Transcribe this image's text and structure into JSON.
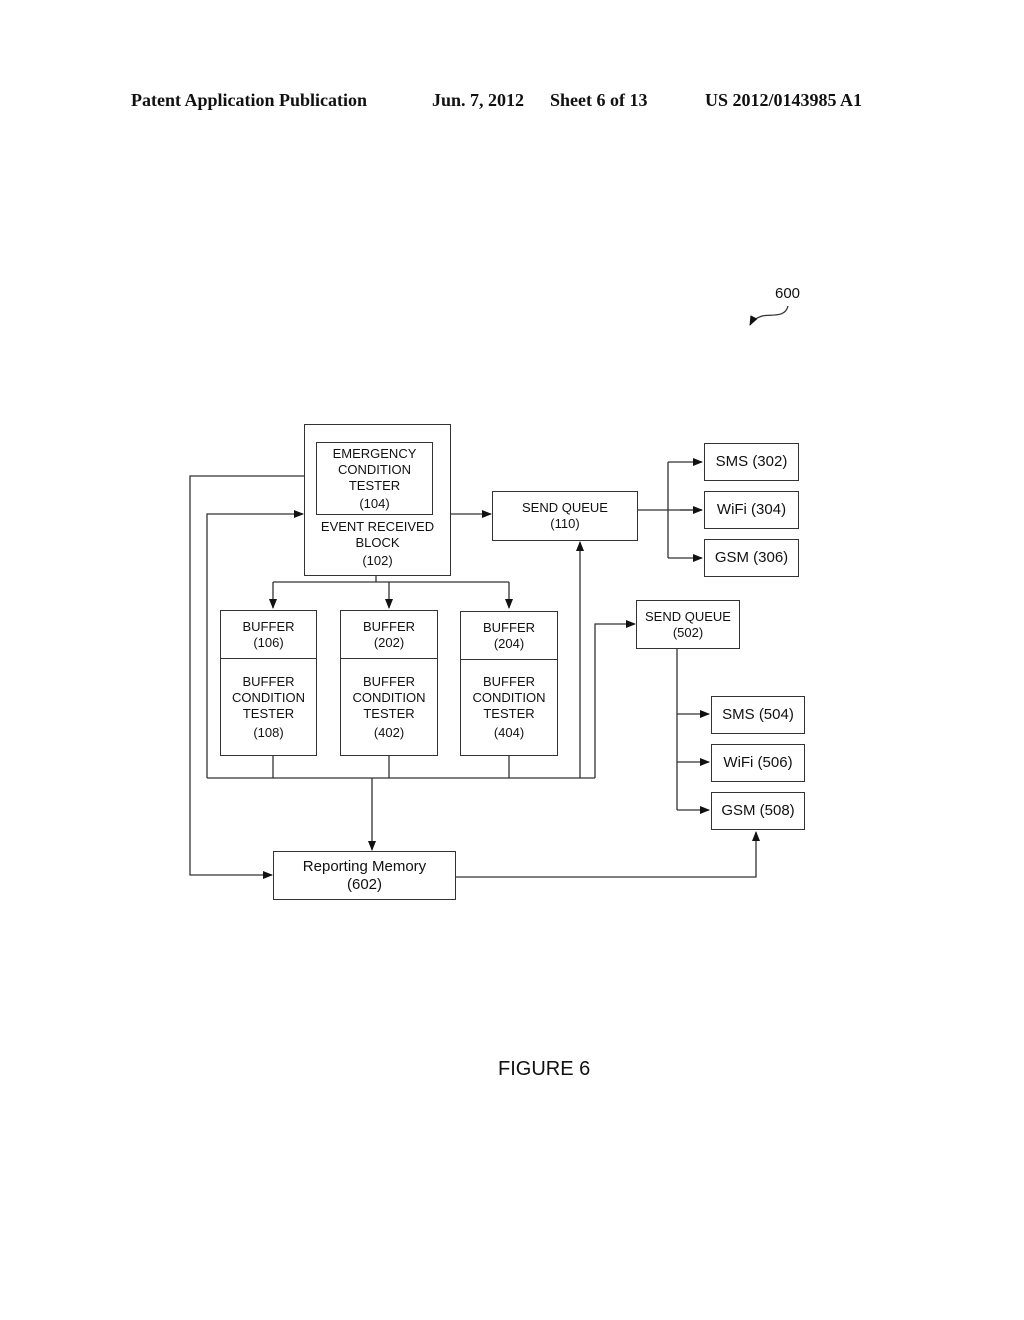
{
  "header": {
    "publication": "Patent Application Publication",
    "date": "Jun. 7, 2012",
    "sheet": "Sheet 6 of 13",
    "number": "US 2012/0143985 A1"
  },
  "figure_ref": "600",
  "figure_caption": "FIGURE 6",
  "blocks": {
    "emergency_tester": [
      "EMERGENCY",
      "CONDITION",
      "TESTER",
      "(104)"
    ],
    "event_received": [
      "EVENT RECEIVED",
      "BLOCK",
      "(102)"
    ],
    "send_queue_110": [
      "SEND QUEUE",
      "(110)"
    ],
    "sms_302": "SMS (302)",
    "wifi_304": "WiFi (304)",
    "gsm_306": "GSM (306)",
    "send_queue_502": [
      "SEND QUEUE",
      "(502)"
    ],
    "sms_504": "SMS (504)",
    "wifi_506": "WiFi (506)",
    "gsm_508": "GSM (508)",
    "buffers": [
      {
        "buffer": [
          "BUFFER",
          "(106)"
        ],
        "tester": [
          "BUFFER",
          "CONDITION",
          "TESTER",
          "(108)"
        ]
      },
      {
        "buffer": [
          "BUFFER",
          "(202)"
        ],
        "tester": [
          "BUFFER",
          "CONDITION",
          "TESTER",
          "(402)"
        ]
      },
      {
        "buffer": [
          "BUFFER",
          "(204)"
        ],
        "tester": [
          "BUFFER",
          "CONDITION",
          "TESTER",
          "(404)"
        ]
      }
    ],
    "reporting_memory": [
      "Reporting Memory",
      "(602)"
    ]
  }
}
